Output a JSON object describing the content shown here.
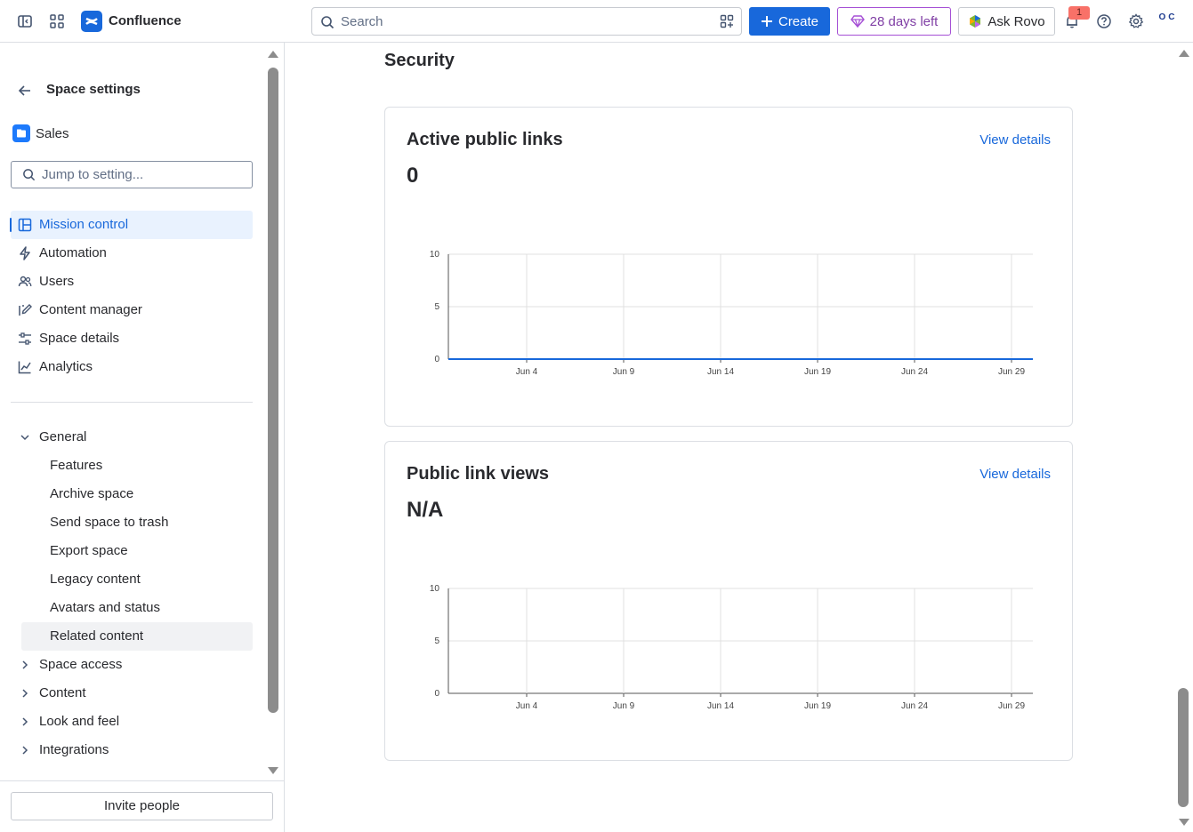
{
  "app": {
    "brand": "Confluence",
    "search_placeholder": "Search",
    "create_label": "Create",
    "trial_label": "28 days left",
    "rovo_label": "Ask Rovo",
    "notification_count": "1",
    "avatar_initials": "OC"
  },
  "sidebar": {
    "title": "Space settings",
    "space_name": "Sales",
    "jump_placeholder": "Jump to setting...",
    "nav": [
      {
        "label": "Mission control",
        "icon": "layout-icon"
      },
      {
        "label": "Automation",
        "icon": "lightning-icon"
      },
      {
        "label": "Users",
        "icon": "people-icon"
      },
      {
        "label": "Content manager",
        "icon": "edit-icon"
      },
      {
        "label": "Space details",
        "icon": "sliders-icon"
      },
      {
        "label": "Analytics",
        "icon": "chart-icon"
      }
    ],
    "general": {
      "label": "General",
      "items": [
        "Features",
        "Archive space",
        "Send space to trash",
        "Export space",
        "Legacy content",
        "Avatars and status",
        "Related content"
      ]
    },
    "groups": [
      "Space access",
      "Content",
      "Look and feel",
      "Integrations"
    ],
    "invite_label": "Invite people"
  },
  "main": {
    "section_title": "Security",
    "cards": [
      {
        "title": "Active public links",
        "link": "View details",
        "value": "0"
      },
      {
        "title": "Public link views",
        "link": "View details",
        "value": "N/A"
      }
    ]
  },
  "chart_data": [
    {
      "type": "line",
      "title": "Active public links",
      "categories": [
        "Jun 4",
        "Jun 9",
        "Jun 14",
        "Jun 19",
        "Jun 24",
        "Jun 29"
      ],
      "y_ticks": [
        "10",
        "5",
        "0"
      ],
      "ylim": [
        0,
        10
      ],
      "series": [
        {
          "values": [
            0,
            0,
            0,
            0,
            0,
            0
          ],
          "color": "#1868db"
        }
      ]
    },
    {
      "type": "line",
      "title": "Public link views",
      "categories": [
        "Jun 4",
        "Jun 9",
        "Jun 14",
        "Jun 19",
        "Jun 24",
        "Jun 29"
      ],
      "y_ticks": [
        "10",
        "5",
        "0"
      ],
      "ylim": [
        0,
        10
      ],
      "series": []
    }
  ],
  "colors": {
    "accent": "#1868db",
    "trial": "#803fa5",
    "active_bg": "#e9f2fe"
  }
}
